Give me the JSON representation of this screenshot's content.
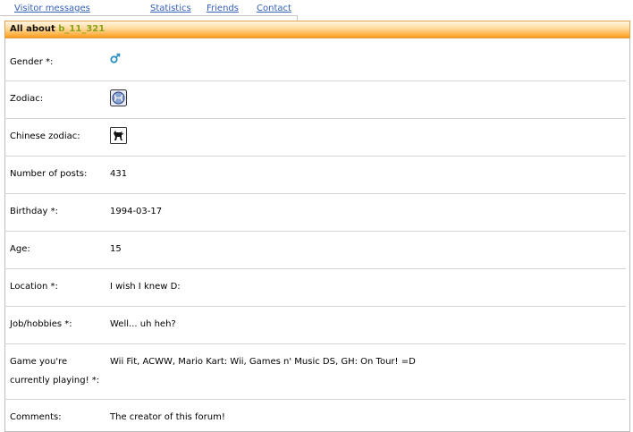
{
  "tabs": [
    {
      "label": "Visitor messages"
    },
    {
      "label": "Statistics"
    },
    {
      "label": "Friends"
    },
    {
      "label": "Contact"
    }
  ],
  "header": {
    "prefix": "All about",
    "username": "b_11_321"
  },
  "profile": {
    "gender": {
      "label": "Gender *:",
      "icon": "male-symbol-icon"
    },
    "zodiac": {
      "label": "Zodiac:",
      "icon": "pisces-icon"
    },
    "chinese_zodiac": {
      "label": "Chinese zodiac:",
      "icon": "dog-icon"
    },
    "posts": {
      "label": "Number of posts:",
      "value": "431"
    },
    "birthday": {
      "label": "Birthday *:",
      "value": "1994-03-17"
    },
    "age": {
      "label": "Age:",
      "value": "15"
    },
    "location": {
      "label": "Location *:",
      "value": "I wish I knew D:"
    },
    "job": {
      "label": "Job/hobbies *:",
      "value": "Well... uh heh?"
    },
    "game": {
      "label_line1": "Game you're",
      "label_line2": "currently playing! *:",
      "value": "Wii Fit, ACWW, Mario Kart: Wii, Games n' Music DS, GH: On Tour! =D"
    },
    "comments": {
      "label": "Comments:",
      "value": "The creator of this forum!"
    }
  },
  "colors": {
    "link": "#3360b8",
    "username": "#8aa21a",
    "header_gradient_end": "#ff9a1a",
    "separator": "#d4d4d4"
  }
}
